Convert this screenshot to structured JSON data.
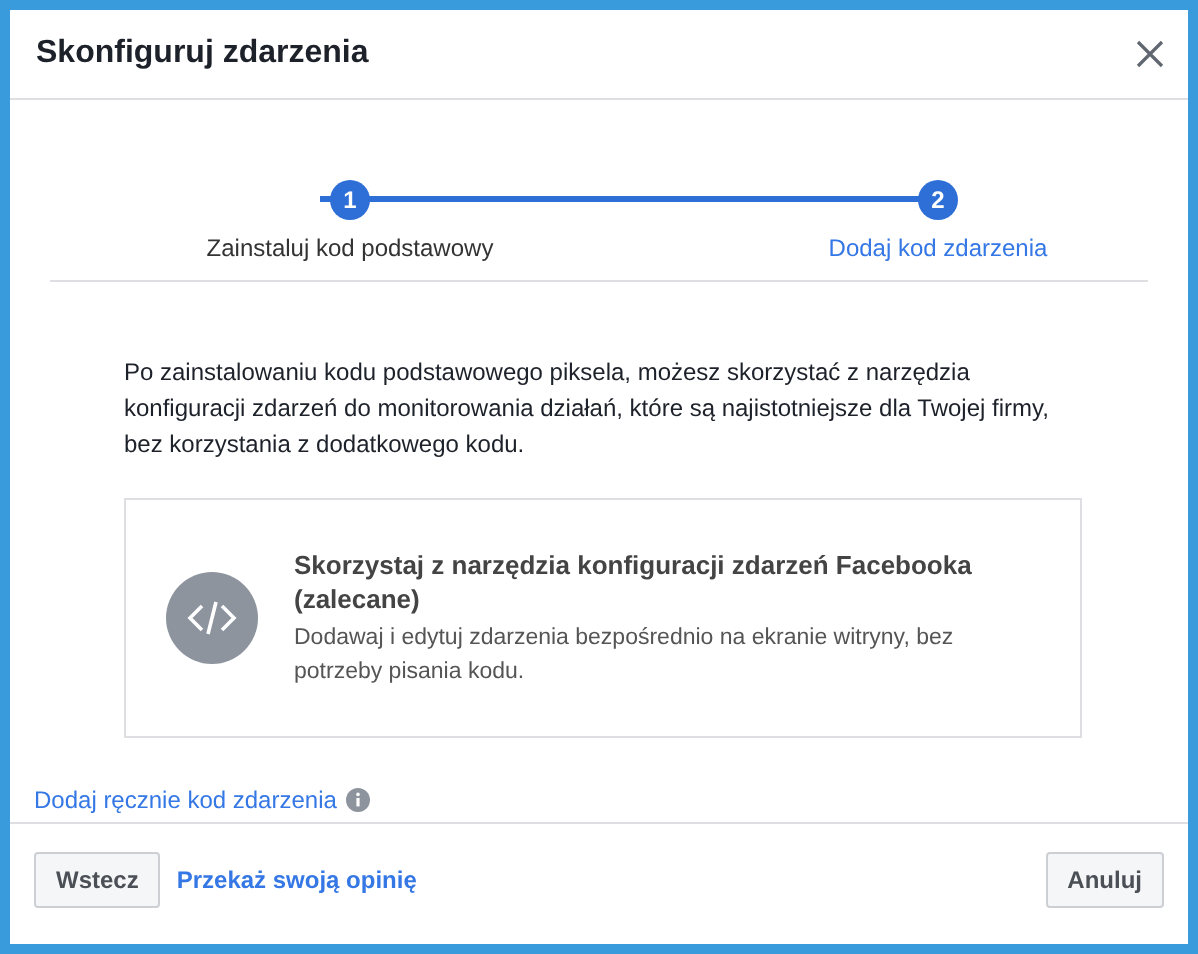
{
  "dialog": {
    "title": "Skonfiguruj zdarzenia"
  },
  "steps": [
    {
      "number": "1",
      "label": "Zainstaluj kod podstawowy",
      "selected": false
    },
    {
      "number": "2",
      "label": "Dodaj kod zdarzenia",
      "selected": true
    }
  ],
  "intro": "Po zainstalowaniu kodu podstawowego piksela, możesz skorzystać z narzędzia konfiguracji zdarzeń do monitorowania działań, które są najistotniejsze dla Twojej firmy, bez korzystania z dodatkowego kodu.",
  "option": {
    "title": "Skorzystaj z narzędzia konfiguracji zdarzeń Facebooka (zalecane)",
    "description": "Dodawaj i edytuj zdarzenia bezpośrednio na ekranie witryny, bez potrzeby pisania kodu."
  },
  "manual_link": "Dodaj ręcznie kod zdarzenia",
  "footer": {
    "back": "Wstecz",
    "feedback": "Przekaż swoją opinię",
    "cancel": "Anuluj"
  }
}
